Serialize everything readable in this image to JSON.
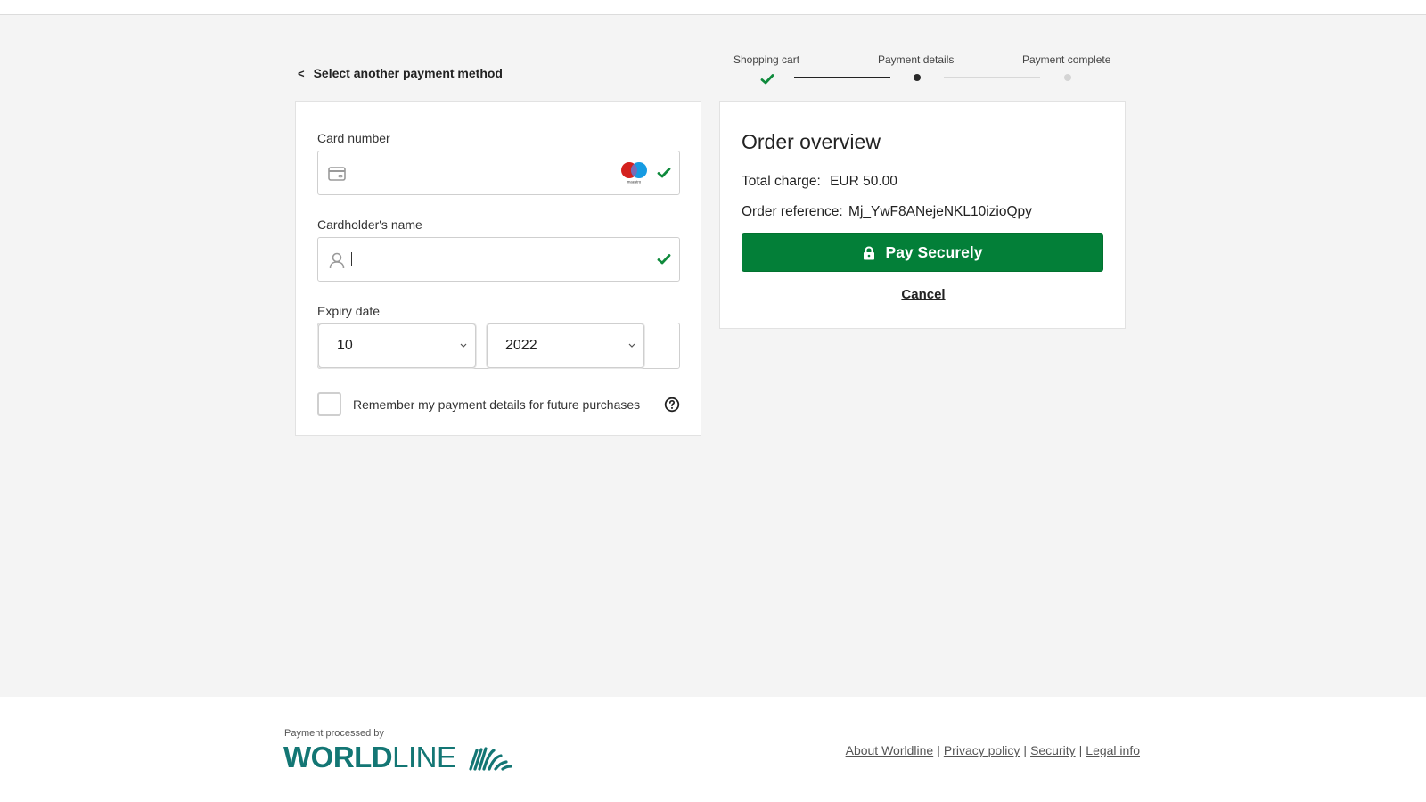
{
  "header": {
    "back_link": "Select another payment method",
    "back_chevron": "<"
  },
  "stepper": {
    "steps": [
      {
        "label": "Shopping cart",
        "state": "complete"
      },
      {
        "label": "Payment details",
        "state": "current"
      },
      {
        "label": "Payment complete",
        "state": "pending"
      }
    ]
  },
  "form": {
    "card_number": {
      "label": "Card number",
      "value": "",
      "brand": "maestro",
      "valid": true,
      "icon": "credit-card-icon"
    },
    "cardholder_name": {
      "label": "Cardholder's name",
      "value": "",
      "valid": true,
      "icon": "person-icon"
    },
    "expiry": {
      "label": "Expiry date",
      "month": "10",
      "year": "2022"
    },
    "remember": {
      "label": "Remember my payment details for future purchases",
      "checked": false
    }
  },
  "order": {
    "title": "Order overview",
    "total_label": "Total charge:",
    "total_value": "EUR 50.00",
    "reference_label": "Order reference:",
    "reference_value": "Mj_YwF8ANejeNKL10izioQpy",
    "pay_button": "Pay Securely",
    "cancel": "Cancel"
  },
  "footer": {
    "processed_by": "Payment processed by",
    "logo_bold": "WORLD",
    "logo_thin": "LINE",
    "links": [
      "About Worldline",
      "Privacy policy",
      "Security",
      "Legal info"
    ],
    "separator": "|"
  },
  "colors": {
    "accent_green": "#037f38",
    "brand_teal": "#137674",
    "maestro_red": "#d4211e",
    "maestro_blue": "#169be2"
  }
}
